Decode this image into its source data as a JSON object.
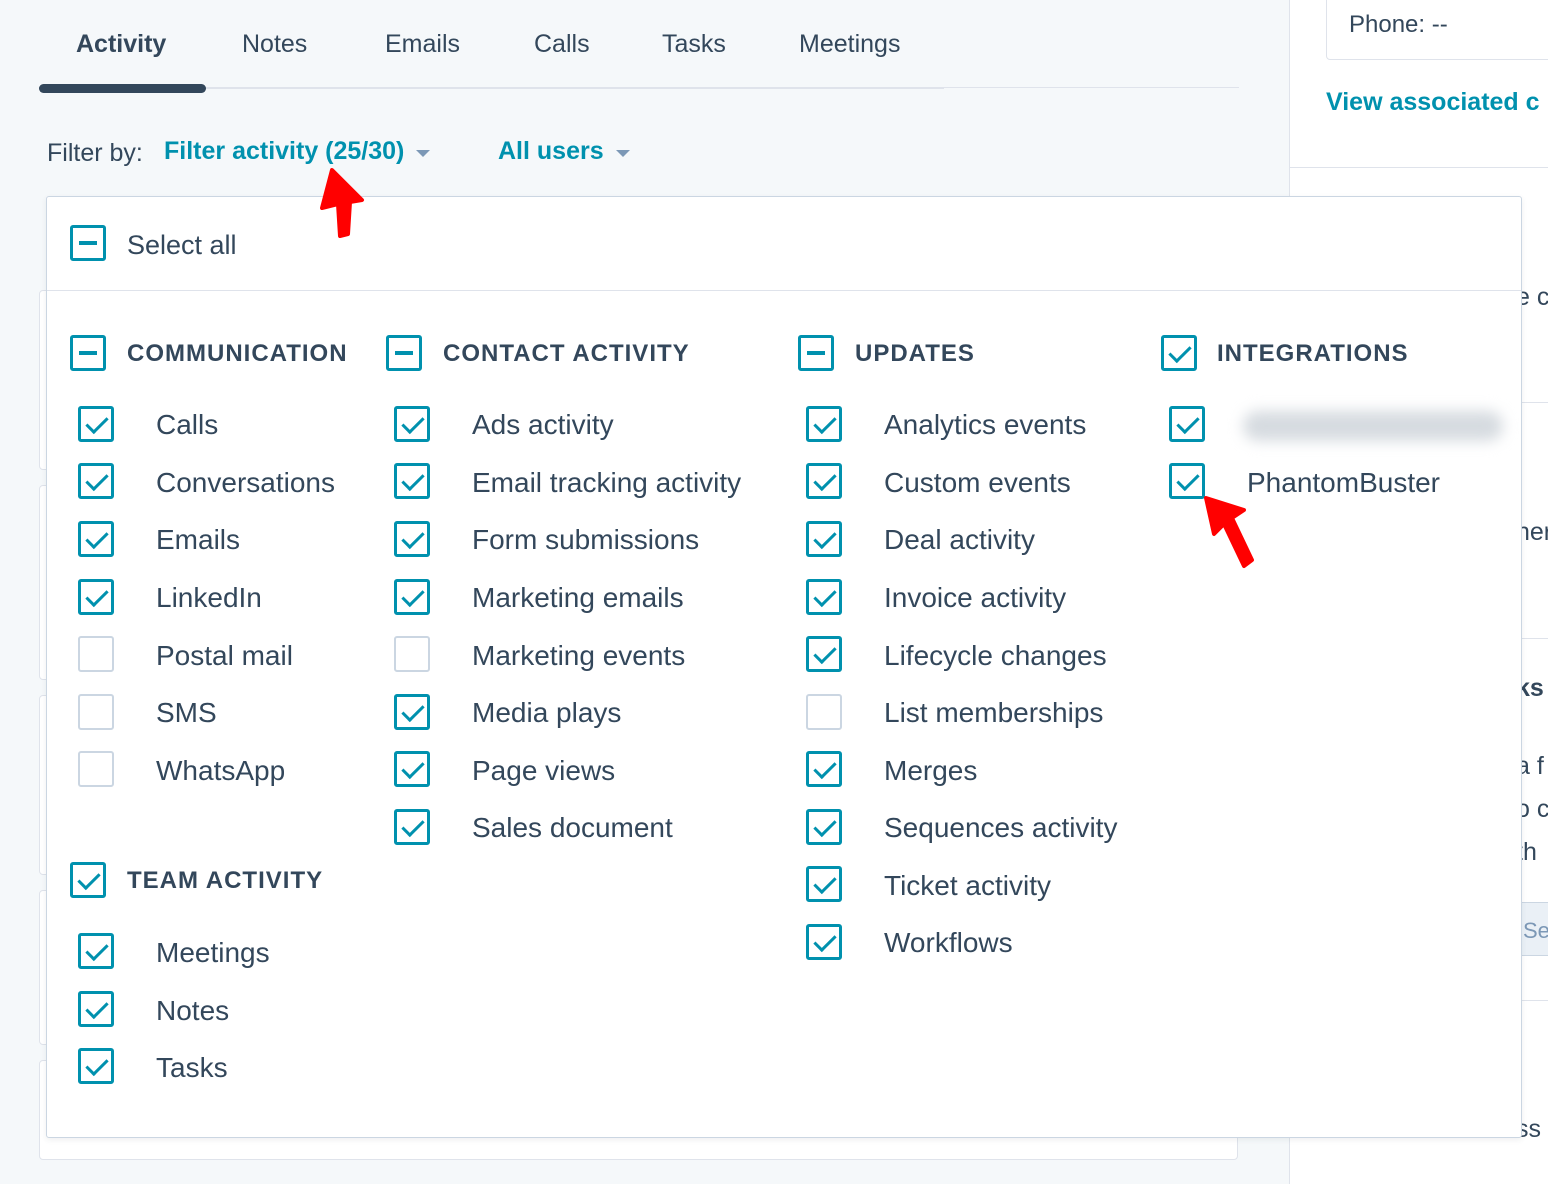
{
  "tabs": [
    {
      "label": "Activity",
      "active": true
    },
    {
      "label": "Notes"
    },
    {
      "label": "Emails"
    },
    {
      "label": "Calls"
    },
    {
      "label": "Tasks"
    },
    {
      "label": "Meetings"
    }
  ],
  "filter": {
    "label": "Filter by:",
    "activity_link": "Filter activity (25/30)",
    "users_link": "All users"
  },
  "right_panel": {
    "phone": "Phone: --",
    "view_associated": "View associated c",
    "fragments": [
      "e c",
      "ner",
      "ks",
      "a f",
      "o c",
      "th",
      "ss"
    ],
    "button_fragment": "Se"
  },
  "dropdown": {
    "select_all": "Select all",
    "groups": {
      "communication": {
        "title": "COMMUNICATION",
        "state": "partial",
        "items": [
          {
            "label": "Calls",
            "checked": true
          },
          {
            "label": "Conversations",
            "checked": true
          },
          {
            "label": "Emails",
            "checked": true
          },
          {
            "label": "LinkedIn",
            "checked": true
          },
          {
            "label": "Postal mail",
            "checked": false
          },
          {
            "label": "SMS",
            "checked": false
          },
          {
            "label": "WhatsApp",
            "checked": false
          }
        ]
      },
      "team_activity": {
        "title": "TEAM ACTIVITY",
        "state": "checked",
        "items": [
          {
            "label": "Meetings",
            "checked": true
          },
          {
            "label": "Notes",
            "checked": true
          },
          {
            "label": "Tasks",
            "checked": true
          }
        ]
      },
      "contact_activity": {
        "title": "CONTACT ACTIVITY",
        "state": "partial",
        "items": [
          {
            "label": "Ads activity",
            "checked": true
          },
          {
            "label": "Email tracking activity",
            "checked": true
          },
          {
            "label": "Form submissions",
            "checked": true
          },
          {
            "label": "Marketing emails",
            "checked": true
          },
          {
            "label": "Marketing events",
            "checked": false
          },
          {
            "label": "Media plays",
            "checked": true
          },
          {
            "label": "Page views",
            "checked": true
          },
          {
            "label": "Sales document",
            "checked": true
          }
        ]
      },
      "updates": {
        "title": "UPDATES",
        "state": "partial",
        "items": [
          {
            "label": "Analytics events",
            "checked": true
          },
          {
            "label": "Custom events",
            "checked": true
          },
          {
            "label": "Deal activity",
            "checked": true
          },
          {
            "label": "Invoice activity",
            "checked": true
          },
          {
            "label": "Lifecycle changes",
            "checked": true
          },
          {
            "label": "List memberships",
            "checked": false
          },
          {
            "label": "Merges",
            "checked": true
          },
          {
            "label": "Sequences activity",
            "checked": true
          },
          {
            "label": "Ticket activity",
            "checked": true
          },
          {
            "label": "Workflows",
            "checked": true
          }
        ]
      },
      "integrations": {
        "title": "INTEGRATIONS",
        "state": "checked",
        "items": [
          {
            "label": "",
            "checked": true,
            "blurred": true
          },
          {
            "label": "PhantomBuster",
            "checked": true
          }
        ]
      }
    }
  },
  "colors": {
    "accent": "#0091ae",
    "text": "#33475b",
    "annotation_arrow": "#ff0000"
  }
}
